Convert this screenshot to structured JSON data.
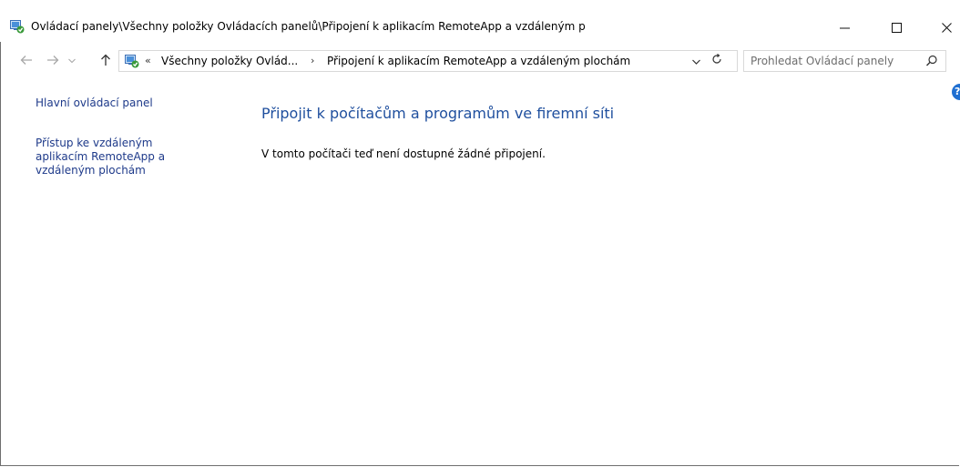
{
  "window": {
    "title": "Ovládací panely\\Všechny položky Ovládacích panelů\\Připojení k aplikacím RemoteApp a vzdáleným p",
    "icon": "remoteapp-control-panel-icon",
    "buttons": {
      "minimize_icon": "minimize-icon",
      "maximize_icon": "maximize-icon",
      "close_icon": "close-icon"
    }
  },
  "navigation": {
    "back_icon": "back-arrow-icon",
    "forward_icon": "forward-arrow-icon",
    "recent_icon": "chevron-down-icon",
    "up_icon": "up-arrow-icon"
  },
  "address_bar": {
    "overflow": "«",
    "breadcrumbs": [
      {
        "label": "Všechny položky Ovlád..."
      },
      {
        "label": "Připojení k aplikacím RemoteApp a vzdáleným plochám"
      }
    ],
    "separator": "›"
  },
  "search": {
    "placeholder": "Prohledat Ovládací panely",
    "value": ""
  },
  "left_nav": {
    "items": [
      {
        "label": "Hlavní ovládací panel"
      },
      {
        "label": "Přístup ke vzdáleným aplikacím RemoteApp a vzdáleným plochám"
      }
    ]
  },
  "main": {
    "heading": "Připojit k počítačům a programům ve firemní síti",
    "status": "V tomto počítači teď není dostupné žádné připojení."
  },
  "help": {
    "label": "?"
  },
  "colors": {
    "link": "#1e3a8a",
    "heading": "#1f4f9e",
    "help_badge": "#1f6fd1",
    "border": "#d9d9d9"
  }
}
